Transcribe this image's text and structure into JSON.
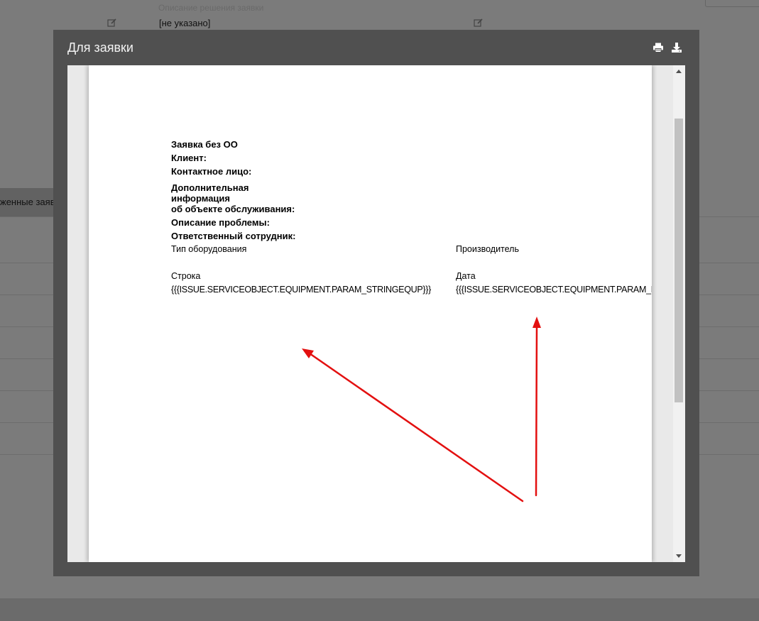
{
  "background": {
    "faint_label": "Описание решения заявки",
    "value": "[не указано]",
    "tab_label": "женные заявки"
  },
  "modal": {
    "title": "Для заявки",
    "print_icon": "print-icon",
    "download_icon": "download-icon"
  },
  "document": {
    "title": "Заявка без ОО",
    "client_label": "Клиент:",
    "contact_label": "Контактное лицо:",
    "additional_info_line1": "Дополнительная",
    "additional_info_line2": "информация",
    "additional_info_line3": "об объекте обслуживания:",
    "problem_label": "Описание проблемы:",
    "responsible_label": "Ответственный сотрудник:",
    "col1_header": "Тип оборудования",
    "col2_header": "Производитель",
    "col1_field": "Строка",
    "col2_field": "Дата",
    "col1_template": "{{{ISSUE.SERVICEOBJECT.EQUIPMENT.PARAM_STRINGEQUP}}}",
    "col2_template": "{{{ISSUE.SERVICEOBJECT.EQUIPMENT.PARAM_DATEEQUP}}}"
  },
  "colors": {
    "modal_bg": "#505050",
    "arrow": "#e31010"
  }
}
